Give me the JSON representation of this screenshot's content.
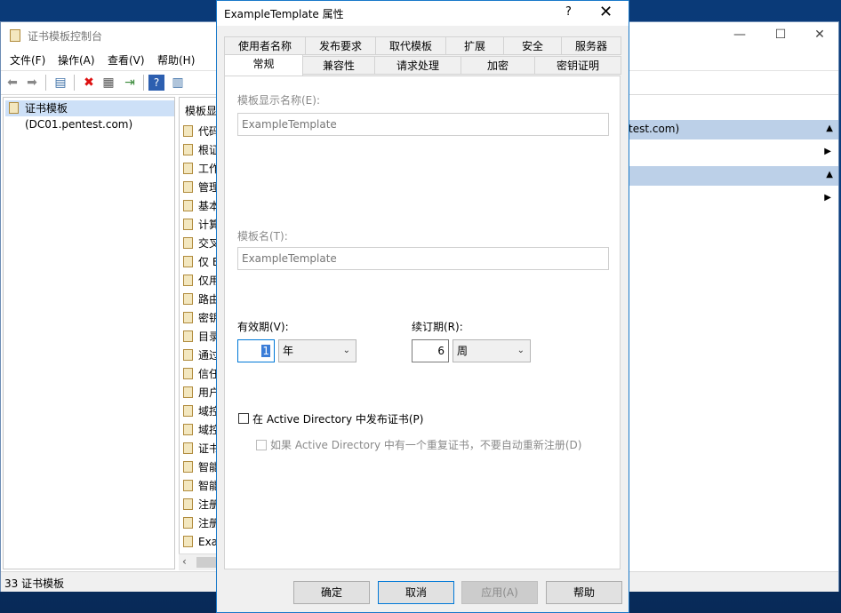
{
  "console": {
    "title": "证书模板控制台",
    "menu": [
      "文件(F)",
      "操作(A)",
      "查看(V)",
      "帮助(H)"
    ],
    "tree_root": "证书模板(DC01.pentest.com)",
    "list_header": "模板显",
    "list_items": [
      "代码",
      "根证",
      "工作",
      "管理",
      "基本",
      "计算",
      "交叉",
      "仅 E",
      "仅用",
      "路由",
      "密钥",
      "目录",
      "通过",
      "信任",
      "用户",
      "域控",
      "域控",
      "证书",
      "智能",
      "智能",
      "注册",
      "注册",
      "Exa"
    ],
    "status": "33 证书模板",
    "actions": {
      "section1": "test.com)",
      "section2": ""
    }
  },
  "dialog": {
    "title": "ExampleTemplate 属性",
    "help_glyph": "?",
    "close_glyph": "✕",
    "tabs_row1": [
      "使用者名称",
      "发布要求",
      "取代模板",
      "扩展",
      "安全",
      "服务器"
    ],
    "tabs_row2": [
      "常规",
      "兼容性",
      "请求处理",
      "加密",
      "密钥证明"
    ],
    "active_tab": "常规",
    "display_name_label": "模板显示名称(E):",
    "display_name_value": "ExampleTemplate",
    "template_name_label": "模板名(T):",
    "template_name_value": "ExampleTemplate",
    "validity_label": "有效期(V):",
    "validity_value": "1",
    "validity_unit": "年",
    "renewal_label": "续订期(R):",
    "renewal_value": "6",
    "renewal_unit": "周",
    "publish_ad_label": "在 Active Directory 中发布证书(P)",
    "no_reenroll_label": "如果 Active Directory 中有一个重复证书，不要自动重新注册(D)",
    "buttons": {
      "ok": "确定",
      "cancel": "取消",
      "apply": "应用(A)",
      "help": "帮助"
    }
  }
}
